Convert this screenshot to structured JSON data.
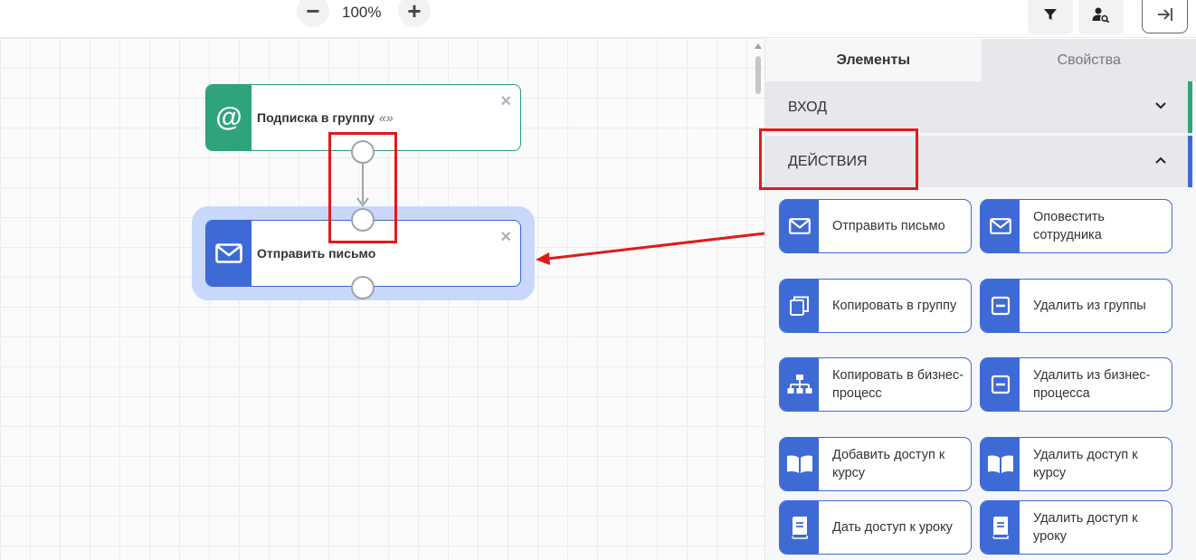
{
  "toolbar": {
    "zoom_out_label": "−",
    "zoom_value": "100%",
    "zoom_in_label": "+",
    "filter_icon": "filter-icon",
    "user_search_icon": "user-search-icon",
    "collapse_icon": "collapse-panel-icon"
  },
  "canvas": {
    "nodes": [
      {
        "id": "subscribe",
        "icon": "at-icon",
        "icon_glyph": "@",
        "title": "Подписка в группу",
        "quote": "«»",
        "close": "×"
      },
      {
        "id": "send-mail",
        "icon": "envelope-icon",
        "title": "Отправить письмо",
        "close": "×"
      }
    ]
  },
  "panel": {
    "tabs": [
      {
        "label": "Элементы",
        "active": true
      },
      {
        "label": "Свойства",
        "active": false
      }
    ],
    "sections": [
      {
        "label": "ВХОД",
        "expanded": false,
        "accent": "#2fa47c"
      },
      {
        "label": "ДЕЙСТВИЯ",
        "expanded": true,
        "accent": "#3e6ad6"
      }
    ],
    "actions": [
      {
        "label": "Отправить письмо",
        "icon": "envelope-icon"
      },
      {
        "label": "Оповестить сотрудника",
        "icon": "envelope-icon"
      },
      {
        "label": "Копировать в группу",
        "icon": "copy-icon"
      },
      {
        "label": "Удалить из группы",
        "icon": "minus-box-icon"
      },
      {
        "label": "Копировать в бизнес-процесс",
        "icon": "hierarchy-icon"
      },
      {
        "label": "Удалить из бизнес-процесса",
        "icon": "minus-box-icon"
      },
      {
        "label": "Добавить доступ к курсу",
        "icon": "open-book-icon"
      },
      {
        "label": "Удалить доступ к курсу",
        "icon": "open-book-icon"
      },
      {
        "label": "Дать доступ к уроку",
        "icon": "book-icon"
      },
      {
        "label": "Удалить доступ к уроку",
        "icon": "book-icon"
      }
    ]
  },
  "colors": {
    "accent_blue": "#3e6ad6",
    "accent_green": "#2fa47c",
    "annotation_red": "#e01b1b"
  }
}
